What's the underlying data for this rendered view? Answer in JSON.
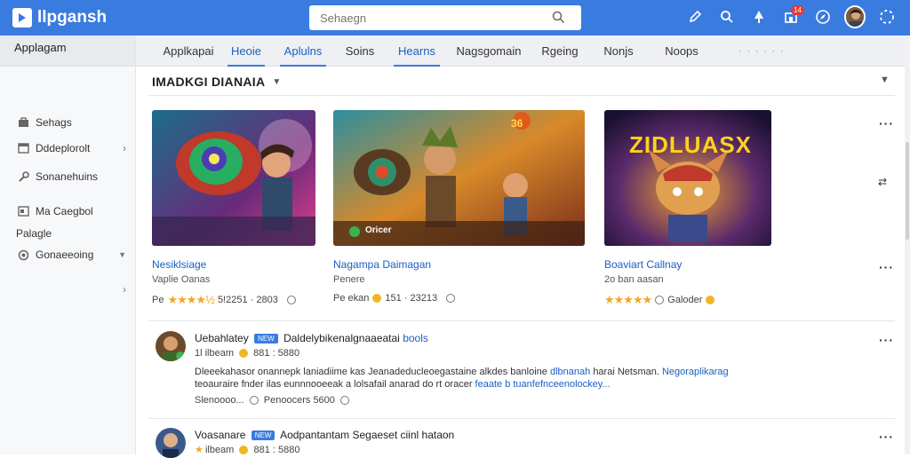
{
  "app": {
    "title": "llpgansh"
  },
  "search": {
    "placeholder": "Sehaegn"
  },
  "top_icons": [
    "edit-icon",
    "search-icon",
    "tree-icon",
    "notifications-icon",
    "compass-icon",
    "avatar",
    "loading-icon"
  ],
  "notification_badge": "14",
  "sidebar": {
    "header": "Applagam",
    "items": [
      {
        "label": "Sehags",
        "icon": "briefcase-icon"
      },
      {
        "label": "Dddeplorolt",
        "icon": "window-icon"
      },
      {
        "label": "Sonanehuins",
        "icon": "wrench-icon"
      },
      {
        "label": "Ma Caegbol",
        "icon": "image-icon"
      },
      {
        "label": "Palagle",
        "icon": ""
      },
      {
        "label": "Gonaeeoing",
        "icon": "circle-icon"
      }
    ]
  },
  "tabs": [
    {
      "label": "Applkapai"
    },
    {
      "label": "Heoie"
    },
    {
      "label": "Aplulns"
    },
    {
      "label": "Soins"
    },
    {
      "label": "Hearns"
    },
    {
      "label": "Nagsgomain"
    },
    {
      "label": "Rgeing"
    },
    {
      "label": "Nonjs"
    },
    {
      "label": "Noops"
    }
  ],
  "section": {
    "title": "IMADKGI DIANAIA"
  },
  "cards": [
    {
      "title": "Nesiklsiage",
      "subtitle": "Vaplie Oanas",
      "meta_prefix": "Pe",
      "rating": 4.5,
      "meta_value": "5!2251 · 2803"
    },
    {
      "title": "Nagampa Daimagan",
      "subtitle": "Penere",
      "meta_prefix": "Pe ekan",
      "meta_value": "151 · 23213",
      "image_badge": "Oricer",
      "image_corner": "36"
    },
    {
      "title": "Boaviart Callnay",
      "subtitle": "2o ban aasan",
      "rating": 5,
      "meta_value": "Galoder",
      "image_text": "ZIDLUASX"
    }
  ],
  "posts": [
    {
      "author": "Uebahlatey",
      "tag": "NEW",
      "headline": "Daldelybikenalgnaaeatai",
      "headline_link": "bools",
      "sub": "1l ilbeam",
      "sub_value": "881 : 5880",
      "body_1": "Dleeekahasor onannepk laniadiime kas Jeanadeducleoegastaine alkdes banloine",
      "body_1_link": "dlbnanah",
      "body_1_tail": "harai Netsman.",
      "body_1_link2": "Negoraplikarag",
      "body_2": "teoauraire fnder ilas eunnnooeeak a lolsafail anarad do rt oracer",
      "body_2_link": "feaate b tuanfefnceenolockey...",
      "foot_prefix": "Slenoooo...",
      "foot_label": "Penoocers",
      "foot_value": "5600"
    },
    {
      "author": "Voasanare",
      "tag": "NEW",
      "headline": "Aodpantantam Segaeset ciinl hataon",
      "sub": "ilbeam",
      "sub_value": "881 : 5880"
    }
  ],
  "colors": {
    "accent": "#3a7be0",
    "link": "#1a5fc4",
    "star": "#f2a922"
  }
}
